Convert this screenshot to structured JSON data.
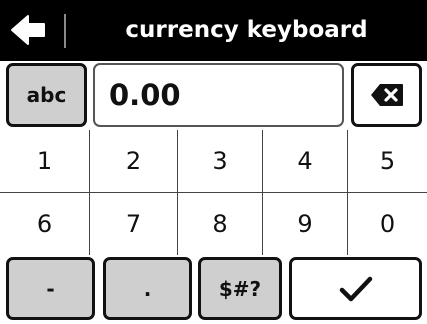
{
  "header": {
    "title": "currency keyboard",
    "back_icon": "back-arrow-icon"
  },
  "input": {
    "value": "0.00"
  },
  "keys": {
    "mode_toggle": "abc",
    "backspace_icon": "backspace-icon",
    "row1": [
      "1",
      "2",
      "3",
      "4",
      "5"
    ],
    "row2": [
      "6",
      "7",
      "8",
      "9",
      "0"
    ],
    "minus": "-",
    "dot": ".",
    "symbols": "$#?",
    "confirm_icon": "checkmark-icon"
  },
  "colors": {
    "bar": "#000000",
    "key_grey": "#cfcfcf",
    "border": "#111111"
  }
}
